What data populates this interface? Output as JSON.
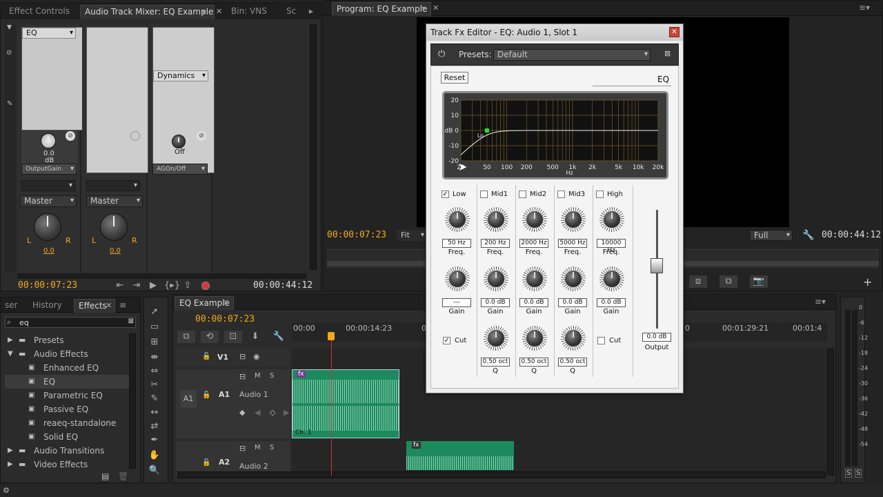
{
  "source_monitor": {
    "tabs": [
      "Effect Controls",
      "Audio Track Mixer: EQ Example",
      "Bin: VNS",
      "Sc"
    ],
    "channels": [
      {
        "slot_label": "EQ",
        "knob_value": "0.0",
        "knob_unit": "dB",
        "param": "OutputGain",
        "send": "Master",
        "pan": "0.0",
        "pan_l": "L",
        "pan_r": "R"
      },
      {
        "slot_label": "",
        "knob_value": "",
        "knob_unit": "",
        "param": "",
        "send": "Master",
        "pan": "0.0",
        "pan_l": "L",
        "pan_r": "R"
      },
      {
        "slot_label": "Dynamics",
        "knob_value": "Off",
        "knob_unit": "",
        "param": "AGOn/Off",
        "send": "",
        "pan": "",
        "pan_l": "",
        "pan_r": ""
      }
    ],
    "timecode_current": "00:00:07:23",
    "timecode_total": "00:00:44:12"
  },
  "program_monitor": {
    "tab": "Program: EQ Example",
    "timecode_current": "00:00:07:23",
    "fit_label": "Fit",
    "full_label": "Full",
    "timecode_total": "00:00:44:12"
  },
  "effects_panel": {
    "tabs": [
      "ser",
      "History",
      "Effects"
    ],
    "search_value": "eq",
    "items": [
      {
        "label": "Presets",
        "level": 0,
        "type": "folder",
        "expanded": false
      },
      {
        "label": "Audio Effects",
        "level": 0,
        "type": "folder",
        "expanded": true
      },
      {
        "label": "Enhanced EQ",
        "level": 1,
        "type": "fx"
      },
      {
        "label": "EQ",
        "level": 1,
        "type": "fx",
        "selected": true
      },
      {
        "label": "Parametric EQ",
        "level": 1,
        "type": "fx"
      },
      {
        "label": "Passive EQ",
        "level": 1,
        "type": "fx"
      },
      {
        "label": "reaeq-standalone",
        "level": 1,
        "type": "fx"
      },
      {
        "label": "Solid EQ",
        "level": 1,
        "type": "fx"
      },
      {
        "label": "Audio Transitions",
        "level": 0,
        "type": "folder",
        "expanded": false
      },
      {
        "label": "Video Effects",
        "level": 0,
        "type": "folder",
        "expanded": false
      }
    ]
  },
  "timeline": {
    "tab": "EQ Example",
    "timecode": "00:00:07:23",
    "ruler": [
      "00:00",
      "00:00:14:23",
      "0",
      "0",
      "00:01:29:21",
      "00:01:4"
    ],
    "tracks": [
      {
        "id": "V1",
        "name": ""
      },
      {
        "src": "A1",
        "id": "A1",
        "name": "Audio 1",
        "clip_label": "Ch. 1"
      },
      {
        "id": "A2",
        "name": "Audio 2"
      }
    ],
    "track_buttons": {
      "m": "M",
      "s": "S"
    },
    "fx_badge": "fx"
  },
  "meter": {
    "labels": [
      "0",
      "-6",
      "-12",
      "-18",
      "-24",
      "-30",
      "-36",
      "-42",
      "-48",
      "-54"
    ],
    "solo": [
      "S",
      "S"
    ]
  },
  "fx_editor": {
    "title": "Track Fx Editor - EQ: Audio 1, Slot 1",
    "presets_label": "Presets:",
    "preset_value": "Default",
    "reset_label": "Reset",
    "eq_label": "EQ",
    "graph": {
      "y_ticks": [
        "20",
        "10",
        "dB 0",
        "-10",
        "-20"
      ],
      "x_ticks": [
        "20",
        "50",
        "100",
        "200",
        "500",
        "1k",
        "2k",
        "5k",
        "10k",
        "20k"
      ],
      "x_unit": "Hz",
      "marker_label": "Lo"
    },
    "bands": [
      {
        "name": "Low",
        "checked": true,
        "freq": "50 Hz",
        "gain": "---",
        "cut": true,
        "cut_label": "Cut"
      },
      {
        "name": "Mid1",
        "checked": false,
        "freq": "200 Hz",
        "gain": "0.0 dB",
        "q": "0.50 oct"
      },
      {
        "name": "Mid2",
        "checked": false,
        "freq": "2000 Hz",
        "gain": "0.0 dB",
        "q": "0.50 oct"
      },
      {
        "name": "Mid3",
        "checked": false,
        "freq": "5000 Hz",
        "gain": "0.0 dB",
        "q": "0.50 oct"
      },
      {
        "name": "High",
        "checked": false,
        "freq": "10000 Hz",
        "gain": "0.0 dB",
        "cut": false,
        "cut_label": "Cut"
      }
    ],
    "freq_label": "Freq.",
    "gain_label": "Gain",
    "q_label": "Q",
    "output_value": "0.0 dB",
    "output_label": "Output"
  }
}
